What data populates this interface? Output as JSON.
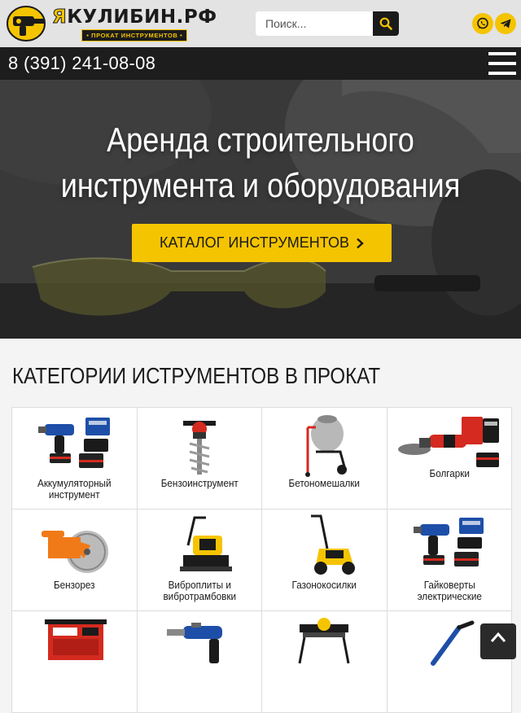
{
  "header": {
    "logo_title_first": "Я",
    "logo_title_rest": "КУЛИБИН.РФ",
    "logo_subtitle": "• ПРОКАТ ИНСТРУМЕНТОВ •",
    "search_placeholder": "Поиск...",
    "search_icon": "search-icon",
    "whatsapp_icon": "whatsapp-icon",
    "telegram_icon": "telegram-icon",
    "phone": "8 (391) 241-08-08",
    "menu_icon": "hamburger-menu-icon"
  },
  "hero": {
    "title_line1": "Аренда строительного",
    "title_line2": "инструмента и оборудования",
    "button_label": "КАТАЛОГ ИНСТРУМЕНТОВ",
    "button_icon": "chevron-right-icon"
  },
  "categories": {
    "heading": "КАТЕГОРИИ ИСТРУМЕНТОВ В ПРОКАТ",
    "items": [
      {
        "label": "Аккумуляторный инструмент",
        "icon": "cordless-impact-wrench-icon"
      },
      {
        "label": "Бензоинструмент",
        "icon": "gas-auger-icon"
      },
      {
        "label": "Бетономешалки",
        "icon": "concrete-mixer-icon"
      },
      {
        "label": "Болгарки",
        "icon": "angle-grinder-icon"
      },
      {
        "label": "Бензорез",
        "icon": "gas-cutoff-saw-icon"
      },
      {
        "label": "Виброплиты и вибротрамбовки",
        "icon": "plate-compactor-icon"
      },
      {
        "label": "Газонокосилки",
        "icon": "lawn-mower-icon"
      },
      {
        "label": "Гайковерты электрические",
        "icon": "electric-impact-wrench-icon"
      },
      {
        "label": "",
        "icon": "generator-icon"
      },
      {
        "label": "",
        "icon": "rotary-hammer-icon"
      },
      {
        "label": "",
        "icon": "tile-saw-icon"
      },
      {
        "label": "",
        "icon": "tool-icon"
      }
    ]
  },
  "colors": {
    "accent": "#f5c400",
    "dark": "#1d1d1d",
    "header_bg": "#e3e3e3",
    "brand_blue": "#1e4fa8",
    "brand_red": "#d42a1f"
  },
  "scroll_top_icon": "chevron-up-icon"
}
